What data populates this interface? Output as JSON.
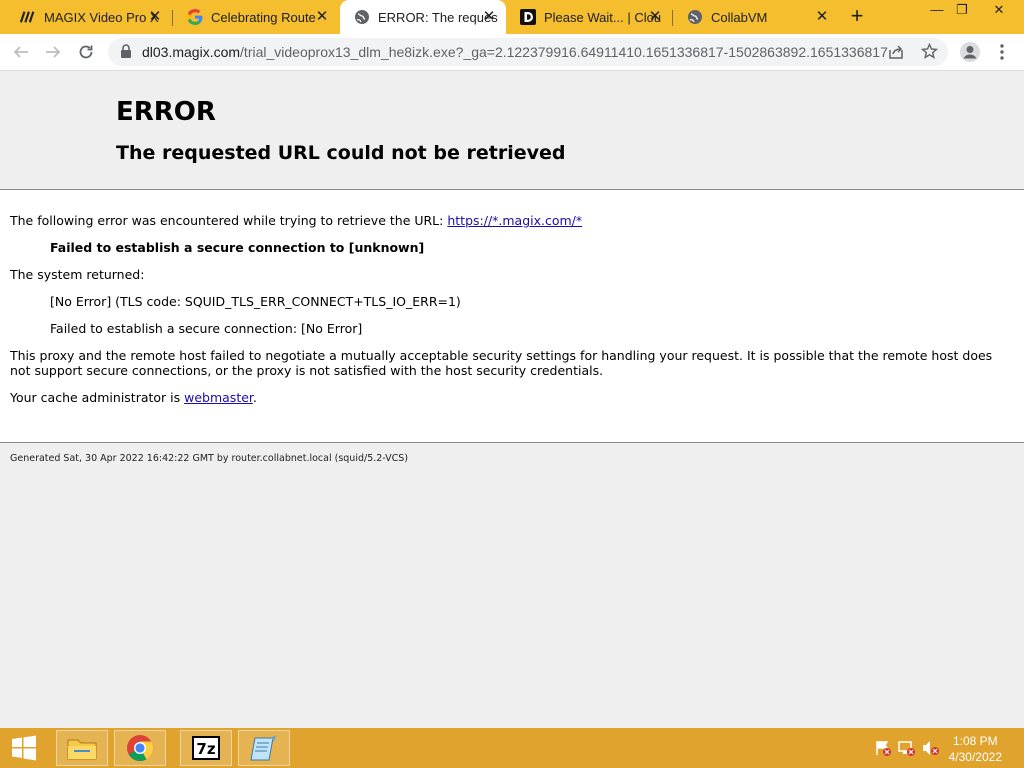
{
  "tabs": [
    {
      "title": "MAGIX Video Pro X",
      "icon": "magix-icon",
      "active": false
    },
    {
      "title": "Celebrating Route",
      "icon": "google-icon",
      "active": false
    },
    {
      "title": "ERROR: The reques",
      "icon": "globe-icon",
      "active": true
    },
    {
      "title": "Please Wait... | Clou",
      "icon": "d-logo-icon",
      "active": false
    },
    {
      "title": "CollabVM",
      "icon": "globe-icon",
      "active": false
    }
  ],
  "address": {
    "url_main": "dl03.magix.com",
    "url_rest": "/trial_videoprox13_dlm_he8izk.exe?_ga=2.122379916.64911410.1651336817-1502863892.1651336817"
  },
  "page": {
    "heading": "ERROR",
    "subheading": "The requested URL could not be retrieved",
    "intro": "The following error was encountered while trying to retrieve the URL: ",
    "intro_link": "https://*.magix.com/*",
    "error_title": "Failed to establish a secure connection to [unknown]",
    "system_returned": "The system returned:",
    "system_line1": "[No Error] (TLS code: SQUID_TLS_ERR_CONNECT+TLS_IO_ERR=1)",
    "system_line2": "Failed to establish a secure connection: [No Error]",
    "explanation": "This proxy and the remote host failed to negotiate a mutually acceptable security settings for handling your request. It is possible that the remote host does not support secure connections, or the proxy is not satisfied with the host security credentials.",
    "admin_prefix": "Your cache administrator is ",
    "admin_link": "webmaster",
    "admin_suffix": ".",
    "footer": "Generated Sat, 30 Apr 2022 16:42:22 GMT by router.collabnet.local (squid/5.2-VCS)"
  },
  "taskbar": {
    "time": "1:08 PM",
    "date": "4/30/2022"
  },
  "colors": {
    "tabstrip": "#f5be2e",
    "taskbar": "#e0a32d",
    "link": "#1a0dab"
  }
}
